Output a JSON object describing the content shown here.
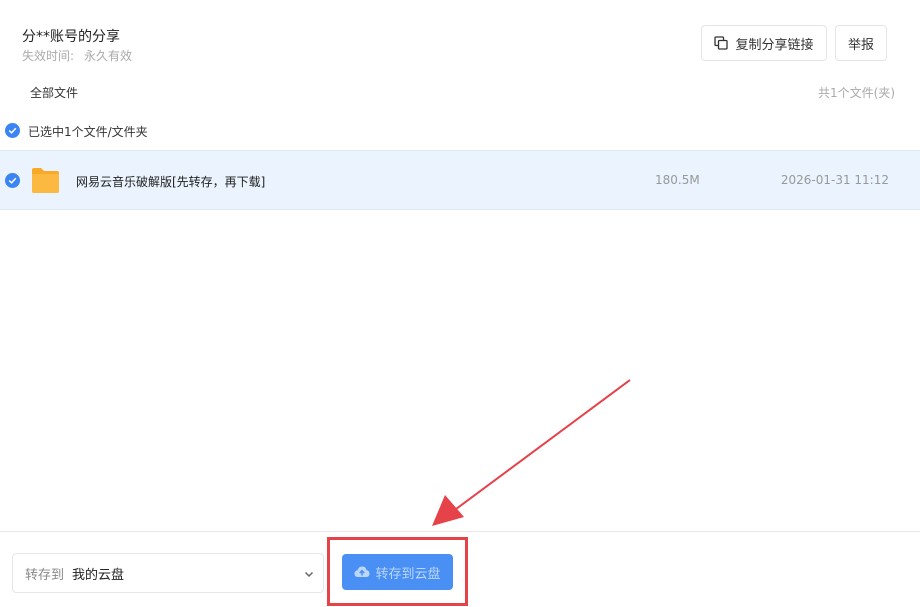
{
  "header": {
    "title": "分**账号的分享",
    "expire_label": "失效时间:",
    "expire_value": "永久有效",
    "copy_link_label": "复制分享链接",
    "report_label": "举报"
  },
  "file_list": {
    "all_files_label": "全部文件",
    "file_count": "共1个文件(夹)",
    "selected_text": "已选中1个文件/文件夹",
    "rows": [
      {
        "name": "网易云音乐破解版[先转存，再下载]",
        "size": "180.5M",
        "date": "2026-01-31 11:12",
        "icon": "folder-icon",
        "selected": true
      }
    ]
  },
  "bottom": {
    "save_to_label": "转存到",
    "save_to_value": "我的云盘",
    "save_button_label": "转存到云盘"
  },
  "colors": {
    "accent": "#3a84f3",
    "selected_row": "#eaf3fe",
    "annotation": "#e5424a",
    "folder": "#fbb942"
  }
}
